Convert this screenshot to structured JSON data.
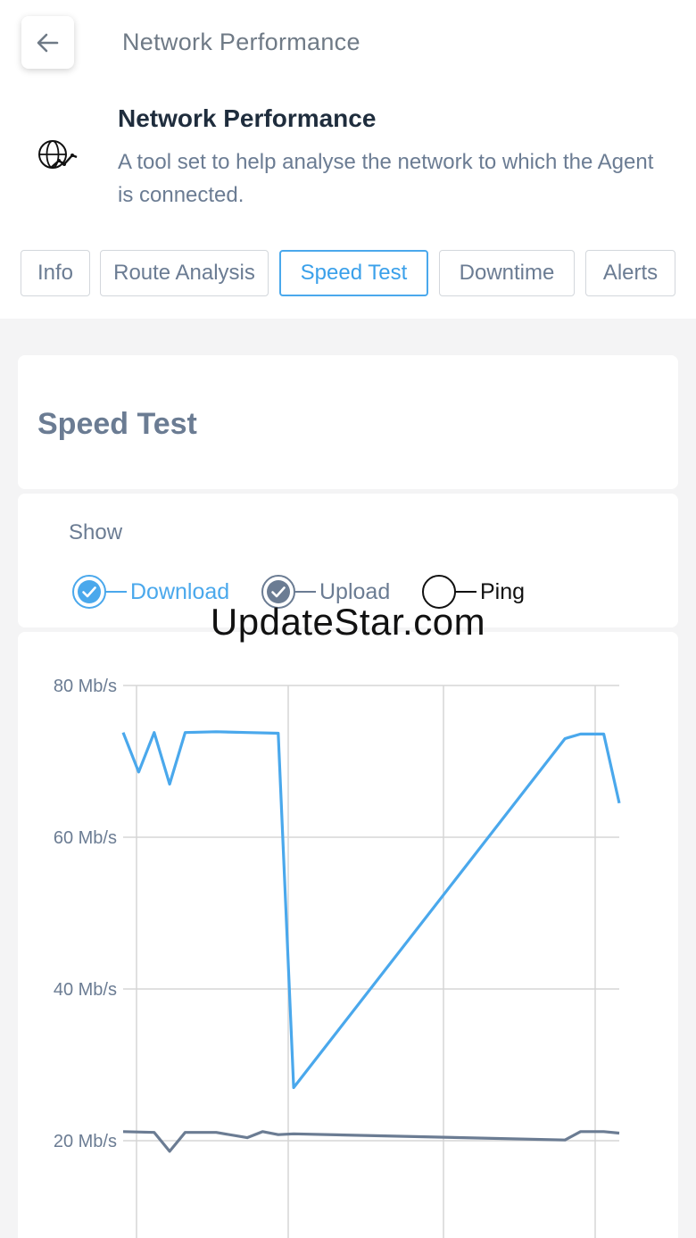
{
  "header": {
    "title": "Network Performance",
    "back_icon": "arrow-left-icon"
  },
  "app": {
    "icon": "globe-chart-icon",
    "name": "Network Performance",
    "description": "A tool set to help analyse the network to which the Agent is connected."
  },
  "tabs": [
    {
      "label": "Info",
      "active": false
    },
    {
      "label": "Route Analysis",
      "active": false
    },
    {
      "label": "Speed Test",
      "active": true
    },
    {
      "label": "Downtime",
      "active": false
    },
    {
      "label": "Alerts",
      "active": false
    }
  ],
  "speed_test": {
    "title": "Speed Test",
    "show_label": "Show",
    "toggles": [
      {
        "label": "Download",
        "checked": true,
        "color": "#4aa8ec"
      },
      {
        "label": "Upload",
        "checked": true,
        "color": "#6b7c93"
      },
      {
        "label": "Ping",
        "checked": false,
        "color": "#111111"
      }
    ]
  },
  "watermark": "UpdateStar.com",
  "colors": {
    "accent": "#4aa8ec",
    "upload": "#6b7c93",
    "grid": "#d6d6d6"
  },
  "chart_data": {
    "type": "line",
    "ylim": [
      15,
      80
    ],
    "yticks": [
      "80 Mb/s",
      "60 Mb/s",
      "40 Mb/s",
      "20 Mb/s"
    ],
    "ytick_values": [
      80,
      60,
      40,
      20
    ],
    "x": [
      0,
      1,
      2,
      3,
      4,
      5,
      6,
      7,
      8,
      9,
      10,
      11,
      12,
      13
    ],
    "series": [
      {
        "name": "Download",
        "color": "#4aa8ec",
        "points": [
          [
            0,
            73.8
          ],
          [
            1,
            68.6
          ],
          [
            2,
            73.8
          ],
          [
            3,
            67.0
          ],
          [
            4,
            73.8
          ],
          [
            6,
            73.9
          ],
          [
            8,
            73.8
          ],
          [
            10,
            73.7
          ],
          [
            11,
            27.0
          ],
          [
            28.5,
            73.0
          ],
          [
            29.5,
            73.6
          ],
          [
            31,
            73.6
          ],
          [
            32,
            64.5
          ]
        ],
        "xmax": 32
      },
      {
        "name": "Upload",
        "color": "#6b7c93",
        "points": [
          [
            0,
            21.2
          ],
          [
            2,
            21.1
          ],
          [
            3,
            18.6
          ],
          [
            4,
            21.1
          ],
          [
            6,
            21.1
          ],
          [
            8,
            20.4
          ],
          [
            9,
            21.2
          ],
          [
            10,
            20.8
          ],
          [
            11,
            20.9
          ],
          [
            28.5,
            20.1
          ],
          [
            29.5,
            21.2
          ],
          [
            31,
            21.2
          ],
          [
            32,
            21.0
          ]
        ],
        "xmax": 32
      }
    ]
  }
}
